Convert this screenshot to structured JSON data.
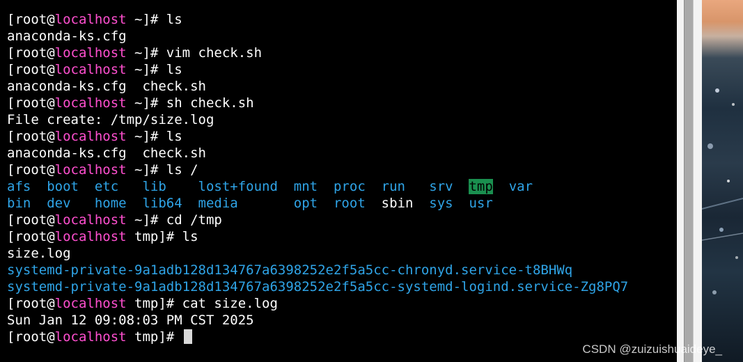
{
  "colors": {
    "background": "#000000",
    "text": "#ffffff",
    "host": "#ff4fcf",
    "dir": "#2fa4e7",
    "tmp_highlight_bg": "#1a8f4f",
    "tmp_highlight_fg": "#000000"
  },
  "terminal": {
    "lines": [
      [
        {
          "t": "[root@",
          "c": "w"
        },
        {
          "t": "localhost",
          "c": "h"
        },
        {
          "t": " ~]# ls",
          "c": "w"
        }
      ],
      [
        {
          "t": "anaconda-ks.cfg",
          "c": "w"
        }
      ],
      [
        {
          "t": "[root@",
          "c": "w"
        },
        {
          "t": "localhost",
          "c": "h"
        },
        {
          "t": " ~]# vim check.sh",
          "c": "w"
        }
      ],
      [
        {
          "t": "[root@",
          "c": "w"
        },
        {
          "t": "localhost",
          "c": "h"
        },
        {
          "t": " ~]# ls",
          "c": "w"
        }
      ],
      [
        {
          "t": "anaconda-ks.cfg  check.sh",
          "c": "w"
        }
      ],
      [
        {
          "t": "[root@",
          "c": "w"
        },
        {
          "t": "localhost",
          "c": "h"
        },
        {
          "t": " ~]# sh check.sh",
          "c": "w"
        }
      ],
      [
        {
          "t": "File create: /tmp/size.log",
          "c": "w"
        }
      ],
      [
        {
          "t": "[root@",
          "c": "w"
        },
        {
          "t": "localhost",
          "c": "h"
        },
        {
          "t": " ~]# ls",
          "c": "w"
        }
      ],
      [
        {
          "t": "anaconda-ks.cfg  check.sh",
          "c": "w"
        }
      ],
      [
        {
          "t": "[root@",
          "c": "w"
        },
        {
          "t": "localhost",
          "c": "h"
        },
        {
          "t": " ~]# ls /",
          "c": "w"
        }
      ],
      [
        {
          "t": "afs  boot  etc   lib    lost+found  mnt  proc  run   srv  ",
          "c": "b"
        },
        {
          "t": "tmp",
          "c": "g"
        },
        {
          "t": "  ",
          "c": "w"
        },
        {
          "t": "var",
          "c": "b"
        }
      ],
      [
        {
          "t": "bin  dev   home  lib64  media       opt  root  ",
          "c": "b"
        },
        {
          "t": "sbin",
          "c": "w"
        },
        {
          "t": "  sys  usr",
          "c": "b"
        }
      ],
      [
        {
          "t": "[root@",
          "c": "w"
        },
        {
          "t": "localhost",
          "c": "h"
        },
        {
          "t": " ~]# cd /tmp",
          "c": "w"
        }
      ],
      [
        {
          "t": "[root@",
          "c": "w"
        },
        {
          "t": "localhost",
          "c": "h"
        },
        {
          "t": " tmp]# ls",
          "c": "w"
        }
      ],
      [
        {
          "t": "size.log",
          "c": "w"
        }
      ],
      [
        {
          "t": "systemd-private-9a1adb128d134767a6398252e2f5a5cc-chronyd.service-t8BHWq",
          "c": "b"
        }
      ],
      [
        {
          "t": "systemd-private-9a1adb128d134767a6398252e2f5a5cc-systemd-logind.service-Zg8PQ7",
          "c": "b"
        }
      ],
      [
        {
          "t": "[root@",
          "c": "w"
        },
        {
          "t": "localhost",
          "c": "h"
        },
        {
          "t": " tmp]# cat size.log",
          "c": "w"
        }
      ],
      [
        {
          "t": "Sun Jan 12 09:08:03 PM CST 2025",
          "c": "w"
        }
      ],
      [
        {
          "t": "[root@",
          "c": "w"
        },
        {
          "t": "localhost",
          "c": "h"
        },
        {
          "t": " tmp]# ",
          "c": "w"
        }
      ]
    ],
    "cursor_line": 19
  },
  "watermark": "CSDN @zuizuishuaideye_"
}
